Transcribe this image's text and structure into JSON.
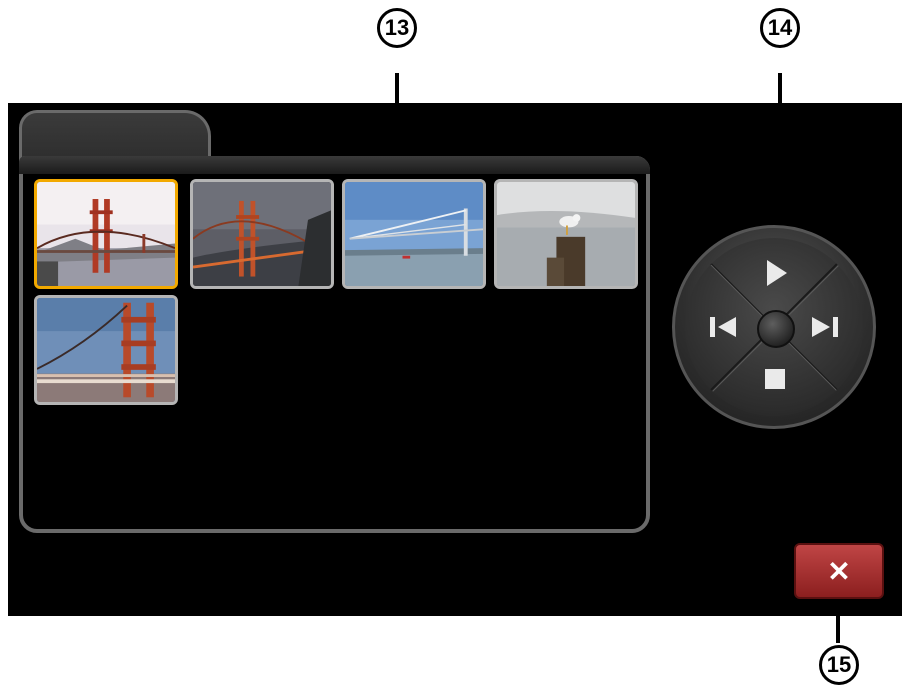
{
  "callouts": {
    "c13": "13",
    "c14": "14",
    "c15": "15"
  },
  "thumbnails": [
    {
      "icon": "golden-gate-bridge-sunset-photo",
      "selected": true
    },
    {
      "icon": "golden-gate-bridge-dusk-photo",
      "selected": false
    },
    {
      "icon": "bay-bridge-photo",
      "selected": false
    },
    {
      "icon": "seagull-on-post-photo",
      "selected": false
    },
    {
      "icon": "golden-gate-bridge-tower-photo",
      "selected": false
    }
  ],
  "controls": {
    "play_icon": "play-icon",
    "prev_icon": "skip-previous-icon",
    "next_icon": "skip-next-icon",
    "stop_icon": "stop-icon"
  },
  "close": {
    "label": "✕",
    "icon": "close-icon",
    "color": "#a83232"
  },
  "colors": {
    "selected_border": "#f2a900",
    "thumb_border": "#b5b5b5",
    "frame": "#6a6a6a"
  }
}
